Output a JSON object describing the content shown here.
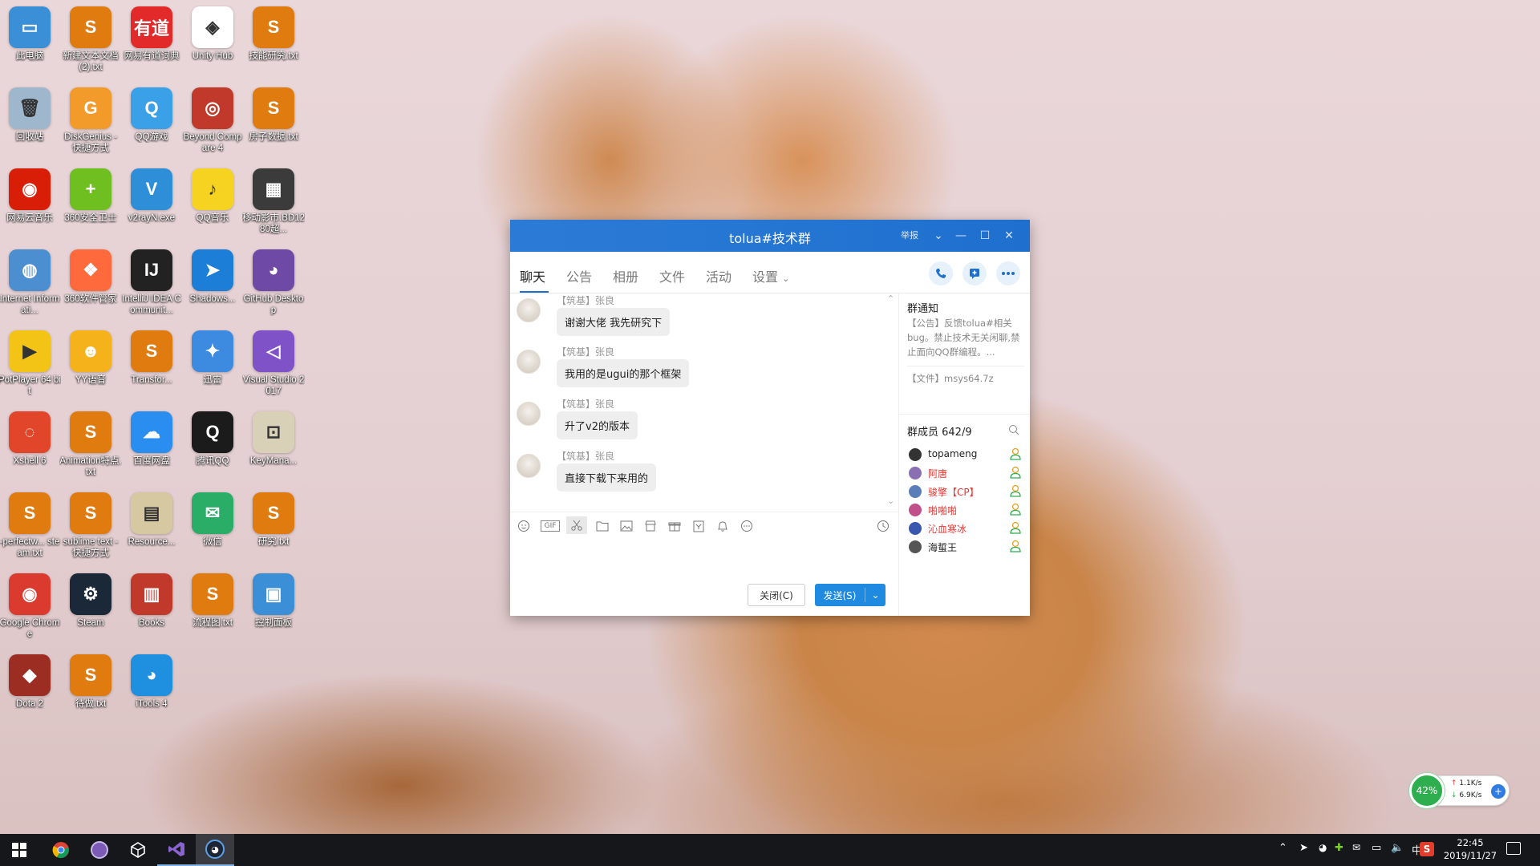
{
  "desktop": {
    "icons": [
      {
        "label": "此电脑",
        "color": "#3b8fd6",
        "glyph": "▭"
      },
      {
        "label": "新建文本文档 (2).txt",
        "color": "#e07b10",
        "glyph": "S"
      },
      {
        "label": "网易有道词典",
        "color": "#e22a2a",
        "glyph": "有道"
      },
      {
        "label": "Unity Hub",
        "color": "#ffffff",
        "glyph": "◈"
      },
      {
        "label": "技能研究.txt",
        "color": "#e07b10",
        "glyph": "S"
      },
      {
        "label": "回收站",
        "color": "#9fb7cc",
        "glyph": "🗑"
      },
      {
        "label": "DiskGenius - 快捷方式",
        "color": "#f29a2a",
        "glyph": "G"
      },
      {
        "label": "QQ游戏",
        "color": "#3aa0e8",
        "glyph": "Q"
      },
      {
        "label": "Beyond Compare 4",
        "color": "#c0392b",
        "glyph": "◎"
      },
      {
        "label": "房子数据.txt",
        "color": "#e07b10",
        "glyph": "S"
      },
      {
        "label": "网易云音乐",
        "color": "#d81e06",
        "glyph": "◉"
      },
      {
        "label": "360安全卫士",
        "color": "#6fbf20",
        "glyph": "+"
      },
      {
        "label": "v2rayN.exe",
        "color": "#2e8fd8",
        "glyph": "V"
      },
      {
        "label": "QQ音乐",
        "color": "#f5d320",
        "glyph": "♪"
      },
      {
        "label": "移动影市.BD1280超...",
        "color": "#3b3b3b",
        "glyph": "▦"
      },
      {
        "label": "Internet Informati...",
        "color": "#4b8fd0",
        "glyph": "◍"
      },
      {
        "label": "360软件管家",
        "color": "#ff6a3d",
        "glyph": "❖"
      },
      {
        "label": "IntelliJ IDEA Communit...",
        "color": "#222222",
        "glyph": "IJ"
      },
      {
        "label": "Shadows...",
        "color": "#1c7ed6",
        "glyph": "➤"
      },
      {
        "label": "GitHub Desktop",
        "color": "#6e4aa6",
        "glyph": "◕"
      },
      {
        "label": "PotPlayer 64 bit",
        "color": "#f3c316",
        "glyph": "▶"
      },
      {
        "label": "YY语音",
        "color": "#f5b21b",
        "glyph": "☻"
      },
      {
        "label": "Transfor...",
        "color": "#e07b10",
        "glyph": "S"
      },
      {
        "label": "迅雷",
        "color": "#3d8be0",
        "glyph": "✦"
      },
      {
        "label": "Visual Studio 2017",
        "color": "#7f52c8",
        "glyph": "◁"
      },
      {
        "label": "Xshell 6",
        "color": "#e2462a",
        "glyph": "◌"
      },
      {
        "label": "Animation特点.txt",
        "color": "#e07b10",
        "glyph": "S"
      },
      {
        "label": "百度网盘",
        "color": "#2a8df0",
        "glyph": "☁"
      },
      {
        "label": "腾讯QQ",
        "color": "#1b1b1b",
        "glyph": "Q"
      },
      {
        "label": "KeyMana...",
        "color": "#d9d0b8",
        "glyph": "⊡"
      },
      {
        "label": "-perfectw... steam.txt",
        "color": "#e07b10",
        "glyph": "S"
      },
      {
        "label": "sublime text - 快捷方式",
        "color": "#e07b10",
        "glyph": "S"
      },
      {
        "label": "Resource...",
        "color": "#d6c8a0",
        "glyph": "▤"
      },
      {
        "label": "微信",
        "color": "#2aae67",
        "glyph": "✉"
      },
      {
        "label": "研究.txt",
        "color": "#e07b10",
        "glyph": "S"
      },
      {
        "label": "Google Chrome",
        "color": "#db3a2e",
        "glyph": "◉"
      },
      {
        "label": "Steam",
        "color": "#1b2838",
        "glyph": "⚙"
      },
      {
        "label": "Books",
        "color": "#c0392b",
        "glyph": "▥"
      },
      {
        "label": "流程图.txt",
        "color": "#e07b10",
        "glyph": "S"
      },
      {
        "label": "控制面板",
        "color": "#3b8fd6",
        "glyph": "▣"
      },
      {
        "label": "Dota 2",
        "color": "#9b2d22",
        "glyph": "◆"
      },
      {
        "label": "待做.txt",
        "color": "#e07b10",
        "glyph": "S"
      },
      {
        "label": "iTools 4",
        "color": "#1f8fe0",
        "glyph": "◕"
      }
    ]
  },
  "chat_window": {
    "title": "tolua#技术群",
    "report": "举报",
    "tabs": [
      "聊天",
      "公告",
      "相册",
      "文件",
      "活动",
      "设置"
    ],
    "messages": [
      {
        "sender": "【筑基】张良",
        "text": "谢谢大佬 我先研究下"
      },
      {
        "sender": "【筑基】张良",
        "text": "我用的是ugui的那个框架"
      },
      {
        "sender": "【筑基】张良",
        "text": "升了v2的版本"
      },
      {
        "sender": "【筑基】张良",
        "text": "直接下载下来用的"
      }
    ],
    "close_button": "关闭(C)",
    "send_button": "发送(S)",
    "notice": {
      "title": "群通知",
      "announcement": "【公告】反馈tolua#相关bug。禁止技术无关闲聊,禁止面向QQ群编程。...",
      "file": "【文件】msys64.7z"
    },
    "members": {
      "title": "群成员 642/9",
      "list": [
        {
          "name": "topameng",
          "color": "#222222"
        },
        {
          "name": "阿唐",
          "color": "#e53935"
        },
        {
          "name": "骏擎【CP】",
          "color": "#e53935"
        },
        {
          "name": "啪啪啪",
          "color": "#e53935"
        },
        {
          "name": "沁血寒冰",
          "color": "#e53935"
        },
        {
          "name": "海蜇王",
          "color": "#222222"
        }
      ]
    }
  },
  "net_widget": {
    "percent": "42%",
    "upload": "1.1K/s",
    "download": "6.9K/s"
  },
  "taskbar": {
    "ime": "中",
    "time": "22:45",
    "date": "2019/11/27"
  }
}
